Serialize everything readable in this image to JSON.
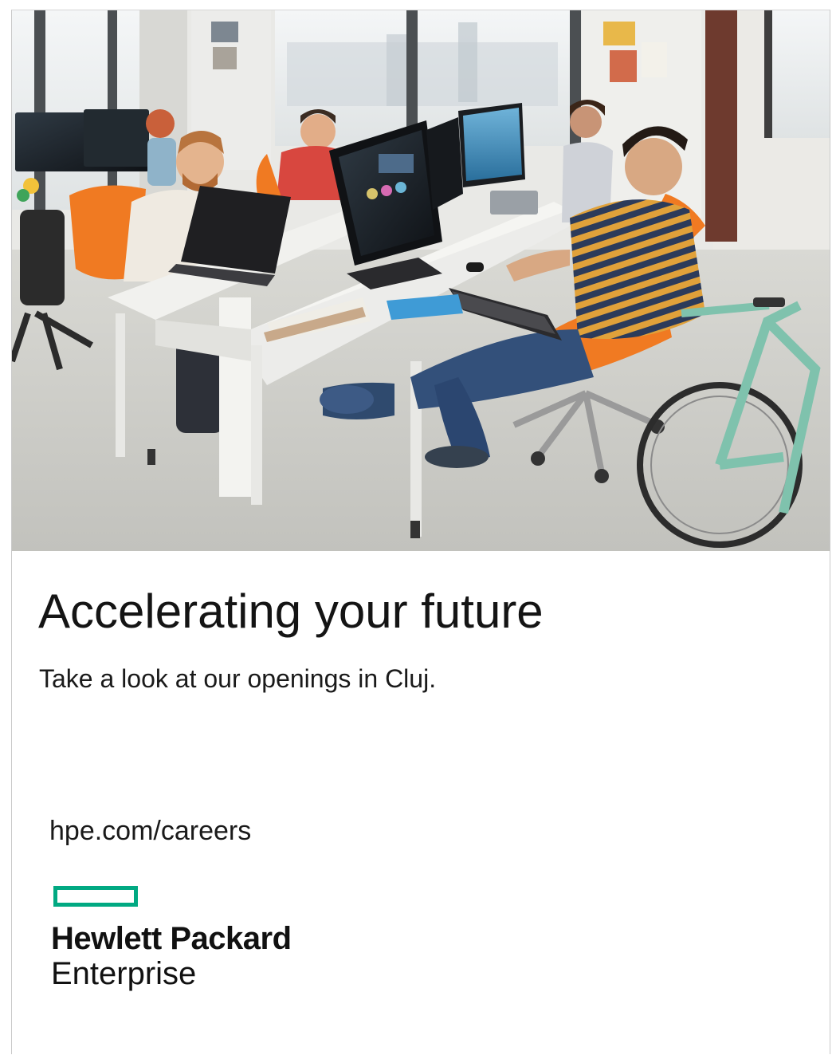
{
  "ad": {
    "headline": "Accelerating your future",
    "subheadline": "Take a look at our openings in Cluj.",
    "url": "hpe.com/careers"
  },
  "logo": {
    "line1": "Hewlett Packard",
    "line2": "Enterprise",
    "accent_color": "#01a982"
  },
  "photo": {
    "icon": "office-photo"
  },
  "colors": {
    "chair_orange": "#f07a22",
    "text": "#141414"
  }
}
